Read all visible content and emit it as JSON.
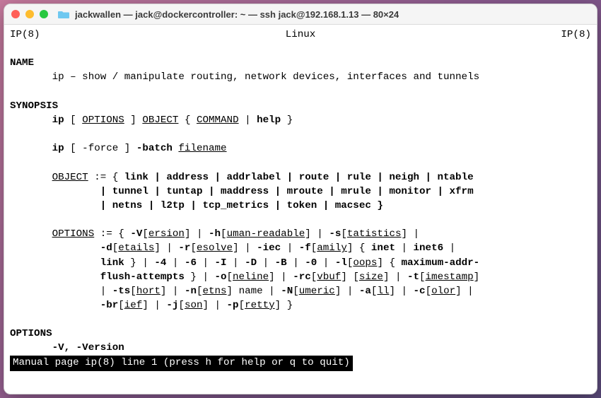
{
  "window": {
    "title": "jackwallen — jack@dockercontroller: ~ — ssh jack@192.168.1.13 — 80×24"
  },
  "man": {
    "header_left": "IP(8)",
    "header_center": "Linux",
    "header_right": "IP(8)",
    "name_heading": "NAME",
    "name_line": "ip – show / manipulate routing, network devices, interfaces and tunnels",
    "synopsis_heading": "SYNOPSIS",
    "syn": {
      "l1": {
        "ip": "ip",
        "lb": "[ ",
        "options": "OPTIONS",
        "rb": " ] ",
        "object": "OBJECT",
        "lb2": " { ",
        "command": "COMMAND",
        "pipe": " | ",
        "help": "help",
        "rb2": " }"
      },
      "l2": {
        "ip": "ip",
        "txt": " [ -force ] ",
        "batch": "-batch",
        "sp": " ",
        "filename": "filename"
      },
      "obj": {
        "label": "OBJECT",
        "assign": " := { ",
        "row1": "link | address | addrlabel | route | rule | neigh | ntable",
        "row2": "| tunnel | tuntap | maddress | mroute | mrule | monitor | xfrm",
        "row3": "| netns | l2tp | tcp_metrics | token | macsec }"
      },
      "opt": {
        "label": "OPTIONS",
        "row1": {
          "a": " := { ",
          "V": "-V",
          "lbV": "[",
          "ersion": "ersion",
          "rb": "]",
          "p": " | ",
          "h": "-h",
          "lbh": "[",
          "uman": "uman-readable",
          "p2": " | ",
          "s": "-s",
          "lbs": "[",
          "tat": "tatistics",
          "end": " |"
        },
        "row2": {
          "d": "-d",
          "lb": "[",
          "etails": "etails",
          "rb": "]",
          "p": " | ",
          "r": "-r",
          "lb2": "[",
          "esolve": "esolve",
          "p2": " | ",
          "iec": "-iec",
          "p3": " | ",
          "f": "-f",
          "lb3": "[",
          "amily": "amily",
          "rb3": "]",
          "brace": " { ",
          "inet": "inet",
          "p4": " | ",
          "inet6": "inet6",
          "end": " |"
        },
        "row3": {
          "link": "link",
          "rb": " } | ",
          "n4": "-4",
          "p": " | ",
          "n6": "-6",
          "p2": " | ",
          "I": "-I",
          "p3": " | ",
          "D": "-D",
          "p4": " | ",
          "B": "-B",
          "p5": " | ",
          "z": "-0",
          "p6": " | ",
          "l": "-l",
          "lb": "[",
          "oops": "oops",
          "rb2": "]",
          "brace": " { ",
          "max": "maximum-addr-"
        },
        "row4": {
          "flush": "flush-attempts",
          "rb": " } | ",
          "o": "-o",
          "lb": "[",
          "neline": "neline",
          "rb2": "]",
          "p": " | ",
          "rc": "-rc",
          "lb2": "[",
          "vbuf": "vbuf",
          "rb3": "]",
          "sp": " ",
          "lb3": "[",
          "size": "size",
          "rb4": "]",
          "p2": " | ",
          "t": "-t",
          "lb4": "[",
          "imestamp": "imestamp",
          "rb5": "]"
        },
        "row5": {
          "p0": "| ",
          "ts": "-ts",
          "lb": "[",
          "hort": "hort",
          "rb": "]",
          "p": " | ",
          "n": "-n",
          "lb2": "[",
          "etns": "etns",
          "rb2": "]",
          "name": " name | ",
          "N": "-N",
          "lb3": "[",
          "umeric": "umeric",
          "rb3": "]",
          "p2": " | ",
          "a": "-a",
          "lb4": "[",
          "ll": "ll",
          "rb4": "]",
          "p3": " | ",
          "c": "-c",
          "lb5": "[",
          "olor": "olor",
          "rb5": "]",
          "end": " |"
        },
        "row6": {
          "br": "-br",
          "lb": "[",
          "ief": "ief",
          "rb": "]",
          "p": " | ",
          "j": "-j",
          "lb2": "[",
          "son": "son",
          "rb2": "]",
          "p2": " | ",
          "pflag": "-p",
          "lb3": "[",
          "retty": "retty",
          "rb3": "]",
          "end": " }"
        }
      }
    },
    "options_heading": "OPTIONS",
    "options_first": "-V, -Version",
    "statusline": "Manual page ip(8) line 1 (press h for help or q to quit)"
  }
}
